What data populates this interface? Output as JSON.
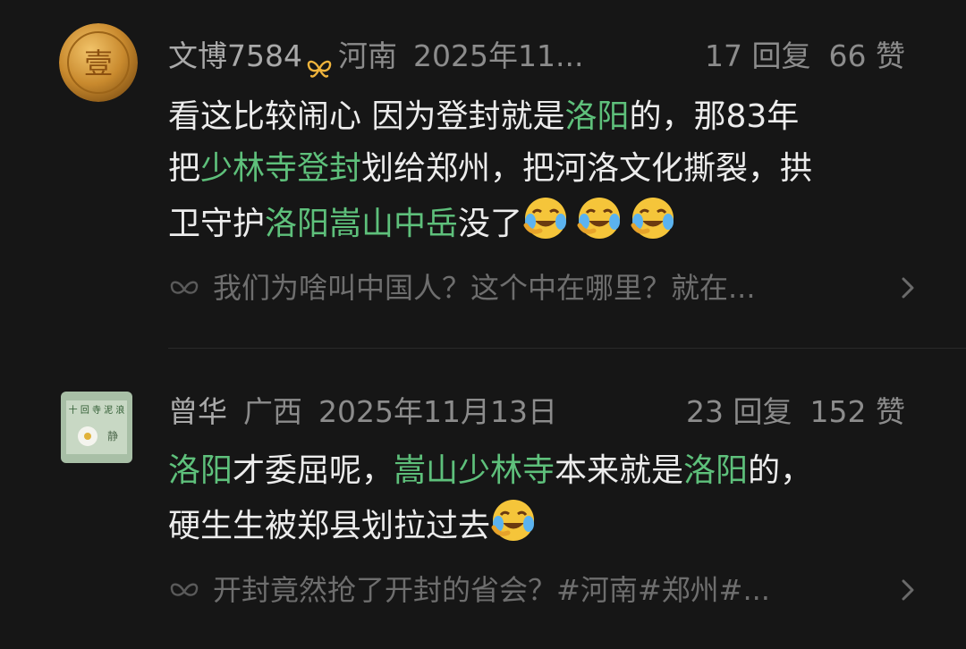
{
  "comments": [
    {
      "user": "文博7584",
      "location": "河南",
      "date": "2025年11...",
      "replies": "17 回复",
      "likes": "66 赞",
      "body_segments": [
        {
          "t": "看这比较闹心 因为登封就是",
          "hl": false
        },
        {
          "t": "洛阳",
          "hl": true
        },
        {
          "t": "的，那83年",
          "hl": false
        }
      ],
      "body_line2": [
        {
          "t": "把",
          "hl": false
        },
        {
          "t": "少林寺登封",
          "hl": true
        },
        {
          "t": "划给郑州，把河洛文化撕裂，拱",
          "hl": false
        }
      ],
      "body_line3": [
        {
          "t": "卫守护",
          "hl": false
        },
        {
          "t": "洛阳嵩山中岳",
          "hl": true
        },
        {
          "t": "没了",
          "hl": false
        }
      ],
      "topic": "我们为啥叫中国人？这个中在哪里？就在..."
    },
    {
      "user": "曾华",
      "location": "广西",
      "date": "2025年11月13日",
      "replies": "23 回复",
      "likes": "152 赞",
      "body_line1": [
        {
          "t": "洛阳",
          "hl": true
        },
        {
          "t": "才委屈呢，",
          "hl": false
        },
        {
          "t": "嵩山少林寺",
          "hl": true
        },
        {
          "t": "本来就是",
          "hl": false
        },
        {
          "t": "洛阳",
          "hl": true
        },
        {
          "t": "的，",
          "hl": false
        }
      ],
      "body_line2": [
        {
          "t": "硬生生被郑县划拉过去",
          "hl": false
        }
      ],
      "topic": "开封竟然抢了开封的省会？#河南#郑州#..."
    }
  ],
  "colors": {
    "highlight": "#5ec07b",
    "background": "#161616"
  },
  "icons": {
    "badge": "butterfly-badge-icon",
    "emoji": "crying-laughing-emoji-icon",
    "topic": "topic-butterfly-icon",
    "chevron": "chevron-right-icon"
  }
}
